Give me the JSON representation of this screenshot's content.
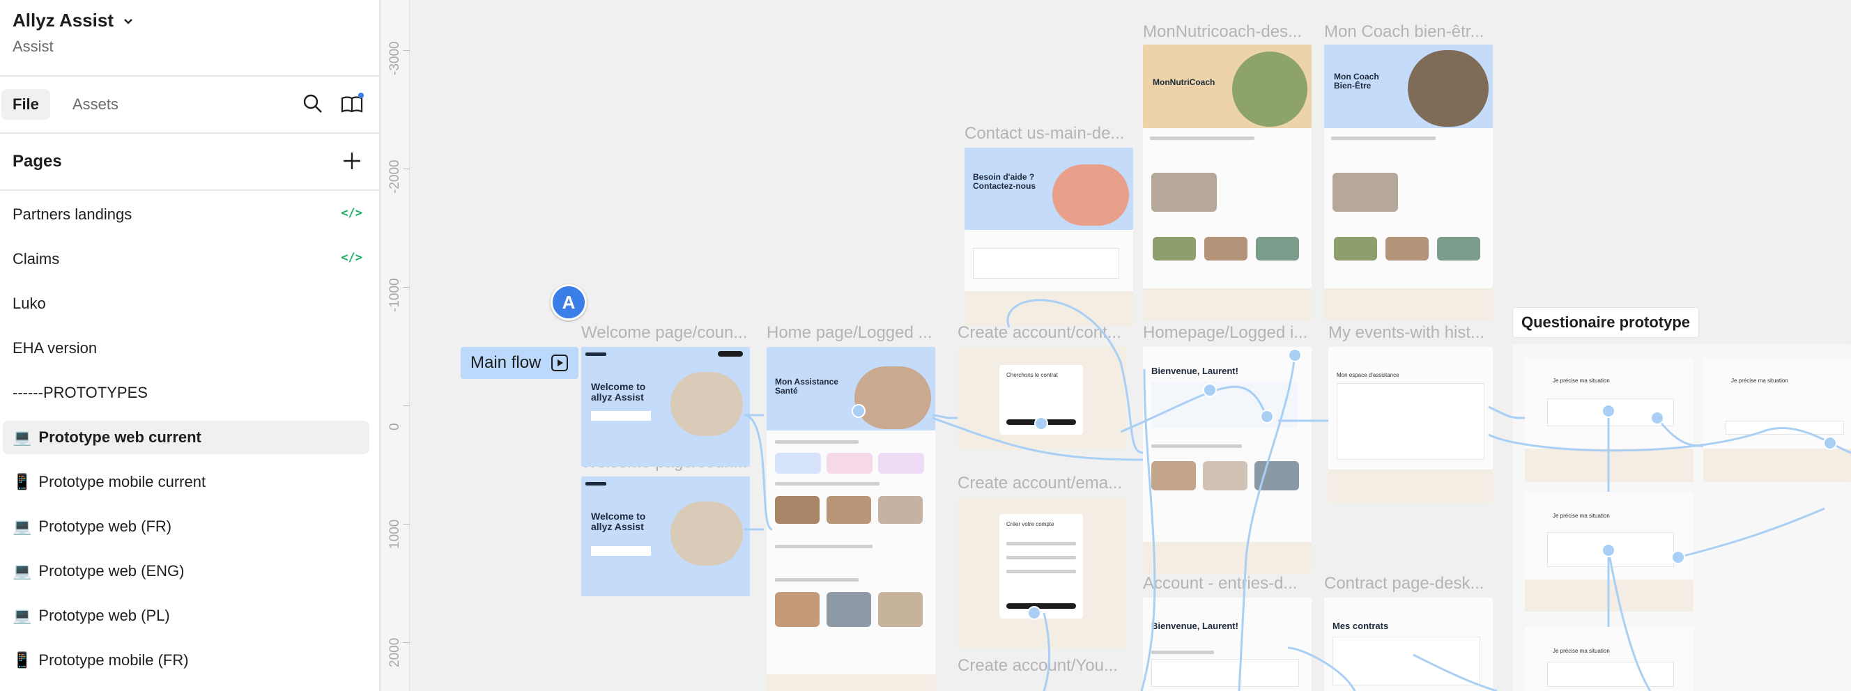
{
  "sidebar": {
    "project_name": "Allyz Assist",
    "project_subtitle": "Assist",
    "tabs": [
      {
        "label": "File"
      },
      {
        "label": "Assets"
      }
    ],
    "pages_title": "Pages",
    "pages": [
      {
        "label": "Partners landings",
        "badge": "</>"
      },
      {
        "label": "Claims",
        "badge": "</>"
      },
      {
        "label": "Luko"
      },
      {
        "label": "EHA version"
      },
      {
        "label": "------PROTOTYPES"
      },
      {
        "label": "Prototype web current",
        "device": "laptop",
        "selected": true
      },
      {
        "label": "Prototype mobile current",
        "device": "mobile"
      },
      {
        "label": "Prototype web (FR)",
        "device": "laptop"
      },
      {
        "label": "Prototype web (ENG)",
        "device": "laptop"
      },
      {
        "label": "Prototype web (PL)",
        "device": "laptop"
      },
      {
        "label": "Prototype mobile (FR)",
        "device": "mobile"
      }
    ],
    "icons": {
      "laptop": "💻",
      "mobile": "📱"
    }
  },
  "canvas": {
    "ruler_ticks": [
      "-3000",
      "-2000",
      "-1000",
      "0",
      "1000",
      "2000"
    ],
    "flow": {
      "label": "Main flow"
    },
    "avatar_initial": "A",
    "section_label": "Questionaire prototype",
    "frame_labels": {
      "welcome1": "Welcome page/coun...",
      "welcome2": "Welcome page/coun...",
      "home": "Home page/Logged ...",
      "contact": "Contact us-main-de...",
      "create1": "Create account/cont...",
      "create2": "Create account/ema...",
      "create3": "Create account/You...",
      "nutri": "MonNutricoach-des...",
      "coach": "Mon Coach bien-êtr...",
      "homelog": "Homepage/Logged i...",
      "events": "My events-with hist...",
      "account": "Account - entries-d...",
      "contract": "Contract page-desk..."
    },
    "frame_text": {
      "welcome_title": "Welcome to allyz Assist",
      "assist_title": "Mon Assistance Santé",
      "contact_title": "Besoin d'aide ? Contactez-nous",
      "nutri_title": "MonNutriCoach",
      "coach_title": "Mon Coach Bien-Être",
      "greeting": "Bienvenue, Laurent!",
      "contracts": "Mes contrats",
      "espace": "Mon espace d'assistance",
      "chercher": "Cherchons le contrat",
      "creer": "Créer votre compte",
      "situation": "Je précise ma situation"
    },
    "colors": {
      "frame_blue": "#c5dbfa",
      "frame_beige": "#f3ede3",
      "connector": "#a9cff5",
      "flow_chip": "#bcd8fb",
      "avatar": "#3b7ee8",
      "code_badge": "#14ae5c"
    }
  }
}
